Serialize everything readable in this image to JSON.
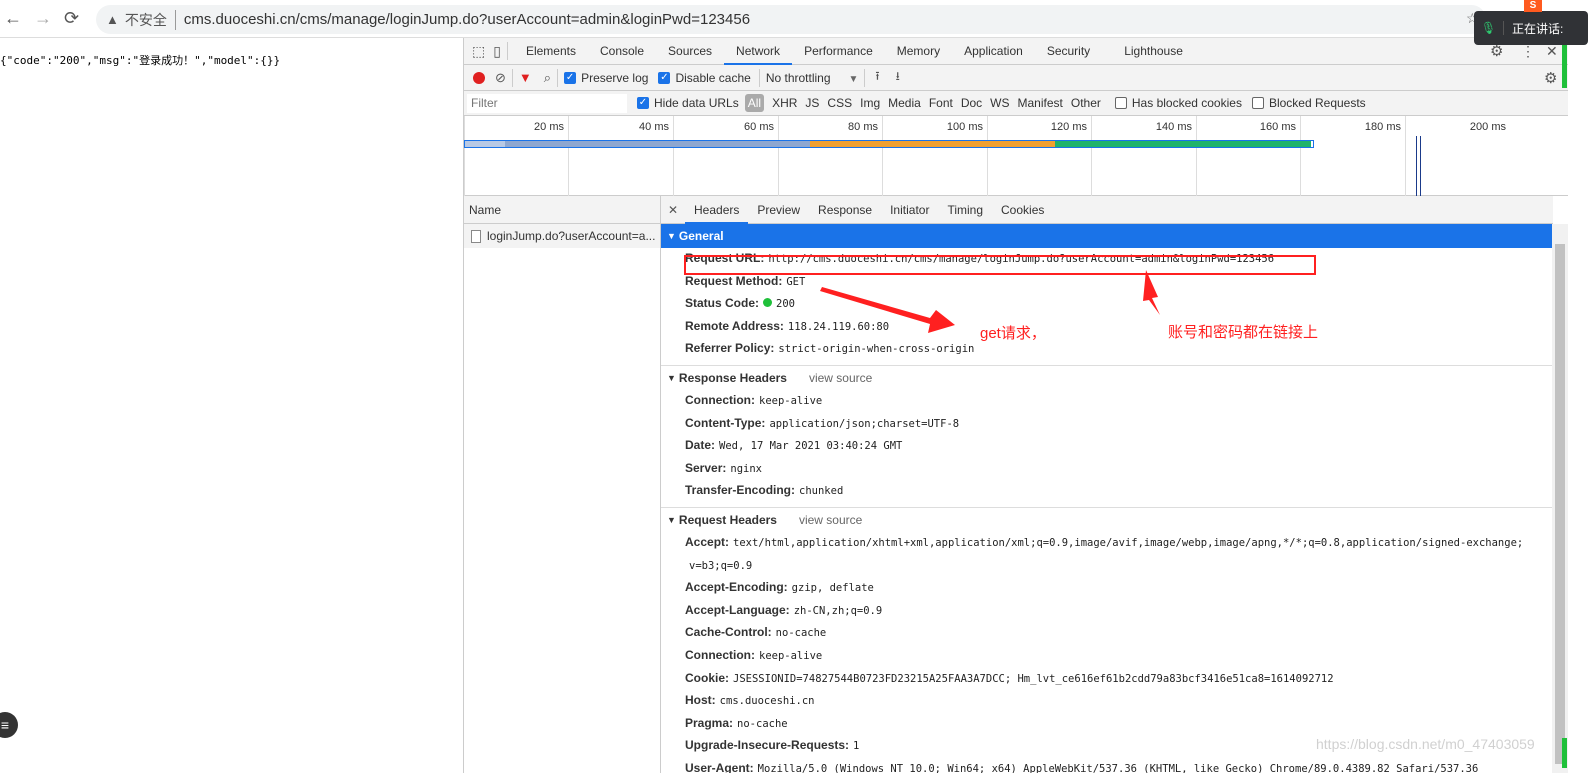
{
  "browser": {
    "back": "←",
    "forward": "→",
    "reload": "⟳",
    "security_label": "不安全",
    "url": "cms.duoceshi.cn/cms/manage/loginJump.do?userAccount=admin&loginPwd=123456",
    "voice_label": "正在讲话:",
    "ext_label": "S"
  },
  "page": {
    "json_text": "{\"code\":\"200\",\"msg\":\"登录成功！\",\"model\":{}}"
  },
  "devtools": {
    "tabs": [
      "Elements",
      "Console",
      "Sources",
      "Network",
      "Performance",
      "Memory",
      "Application",
      "Security",
      "Lighthouse"
    ],
    "active_tab": "Network",
    "toolbar": {
      "preserve_log": "Preserve log",
      "disable_cache": "Disable cache",
      "throttling": "No throttling"
    },
    "filter": {
      "placeholder": "Filter",
      "hide_data_urls": "Hide data URLs",
      "types": [
        "All",
        "XHR",
        "JS",
        "CSS",
        "Img",
        "Media",
        "Font",
        "Doc",
        "WS",
        "Manifest",
        "Other"
      ],
      "has_blocked_cookies": "Has blocked cookies",
      "blocked_requests": "Blocked Requests"
    },
    "timeline": {
      "ticks": [
        "20 ms",
        "40 ms",
        "60 ms",
        "80 ms",
        "100 ms",
        "120 ms",
        "140 ms",
        "160 ms",
        "180 ms",
        "200 ms"
      ]
    },
    "name_header": "Name",
    "request_name": "loginJump.do?userAccount=a...",
    "detail_tabs": [
      "Headers",
      "Preview",
      "Response",
      "Initiator",
      "Timing",
      "Cookies"
    ],
    "general": {
      "title": "General",
      "rows": [
        {
          "k": "Request URL:",
          "v": "http://cms.duoceshi.cn/cms/manage/loginJump.do?userAccount=admin&loginPwd=123456"
        },
        {
          "k": "Request Method:",
          "v": "GET"
        },
        {
          "k": "Status Code:",
          "v": "200"
        },
        {
          "k": "Remote Address:",
          "v": "118.24.119.60:80"
        },
        {
          "k": "Referrer Policy:",
          "v": "strict-origin-when-cross-origin"
        }
      ]
    },
    "response_headers": {
      "title": "Response Headers",
      "view_source": "view source",
      "rows": [
        {
          "k": "Connection:",
          "v": "keep-alive"
        },
        {
          "k": "Content-Type:",
          "v": "application/json;charset=UTF-8"
        },
        {
          "k": "Date:",
          "v": "Wed, 17 Mar 2021 03:40:24 GMT"
        },
        {
          "k": "Server:",
          "v": "nginx"
        },
        {
          "k": "Transfer-Encoding:",
          "v": "chunked"
        }
      ]
    },
    "request_headers": {
      "title": "Request Headers",
      "view_source": "view source",
      "rows": [
        {
          "k": "Accept:",
          "v": "text/html,application/xhtml+xml,application/xml;q=0.9,image/avif,image/webp,image/apng,*/*;q=0.8,application/signed-exchange;"
        },
        {
          "k": "",
          "v": "v=b3;q=0.9"
        },
        {
          "k": "Accept-Encoding:",
          "v": "gzip, deflate"
        },
        {
          "k": "Accept-Language:",
          "v": "zh-CN,zh;q=0.9"
        },
        {
          "k": "Cache-Control:",
          "v": "no-cache"
        },
        {
          "k": "Connection:",
          "v": "keep-alive"
        },
        {
          "k": "Cookie:",
          "v": "JSESSIONID=74827544B0723FD23215A25FAA3A7DCC; Hm_lvt_ce616ef61b2cdd79a83bcf3416e51ca8=1614092712"
        },
        {
          "k": "Host:",
          "v": "cms.duoceshi.cn"
        },
        {
          "k": "Pragma:",
          "v": "no-cache"
        },
        {
          "k": "Upgrade-Insecure-Requests:",
          "v": "1"
        },
        {
          "k": "User-Agent:",
          "v": "Mozilla/5.0 (Windows NT 10.0; Win64; x64) AppleWebKit/537.36 (KHTML, like Gecko) Chrome/89.0.4389.82 Safari/537.36"
        }
      ]
    }
  },
  "annotations": {
    "get_note": "get请求，",
    "account_note": "账号和密码都在链接上",
    "color": "#ff2020"
  },
  "watermark": "https://blog.csdn.net/m0_47403059"
}
